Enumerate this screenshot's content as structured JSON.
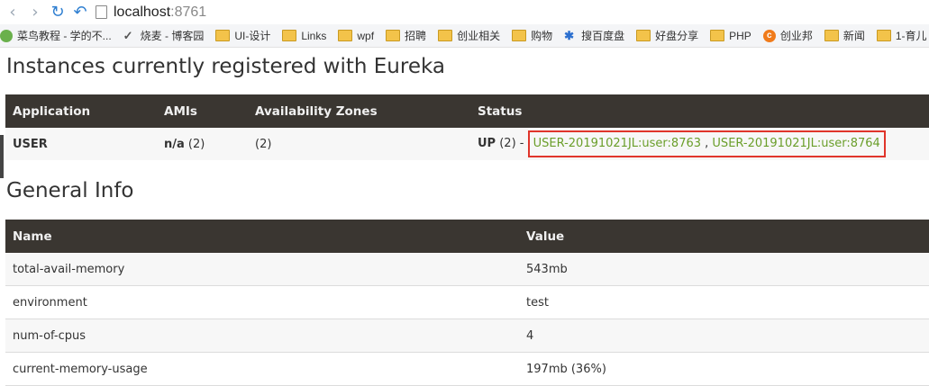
{
  "browser": {
    "url_host": "localhost",
    "url_port": ":8761",
    "bookmarks": [
      {
        "label": "菜鸟教程 - 学的不...",
        "icon": "green-circle-icon"
      },
      {
        "label": "烧麦 - 博客园",
        "icon": "bookmark-mark-icon"
      },
      {
        "label": "UI-设计",
        "icon": "folder-icon"
      },
      {
        "label": "Links",
        "icon": "folder-icon"
      },
      {
        "label": "wpf",
        "icon": "folder-icon"
      },
      {
        "label": "招聘",
        "icon": "folder-icon"
      },
      {
        "label": "创业相关",
        "icon": "folder-icon"
      },
      {
        "label": "购物",
        "icon": "folder-icon"
      },
      {
        "label": "搜百度盘",
        "icon": "blue-mark-icon"
      },
      {
        "label": "好盘分享",
        "icon": "folder-icon"
      },
      {
        "label": "PHP",
        "icon": "folder-icon"
      },
      {
        "label": "创业邦",
        "icon": "orange-badge-icon"
      },
      {
        "label": "新闻",
        "icon": "folder-icon"
      },
      {
        "label": "1-育儿",
        "icon": "folder-icon"
      }
    ]
  },
  "instances": {
    "title": "Instances currently registered with Eureka",
    "headers": {
      "application": "Application",
      "amis": "AMIs",
      "zones": "Availability Zones",
      "status": "Status"
    },
    "row": {
      "application": "USER",
      "amis_na": "n/a",
      "amis_count": " (2)",
      "zones": "(2)",
      "status_up": "UP",
      "status_count": " (2) - ",
      "link1": "USER-20191021JL:user:8763",
      "separator": " , ",
      "link2": "USER-20191021JL:user:8764"
    }
  },
  "general": {
    "title": "General Info",
    "headers": {
      "name": "Name",
      "value": "Value"
    },
    "rows": [
      {
        "name": "total-avail-memory",
        "value": "543mb"
      },
      {
        "name": "environment",
        "value": "test"
      },
      {
        "name": "num-of-cpus",
        "value": "4"
      },
      {
        "name": "current-memory-usage",
        "value": "197mb (36%)"
      }
    ]
  },
  "colors": {
    "header_bg": "#3a3631",
    "link": "#6a9e2a",
    "highlight": "#e0352b"
  }
}
